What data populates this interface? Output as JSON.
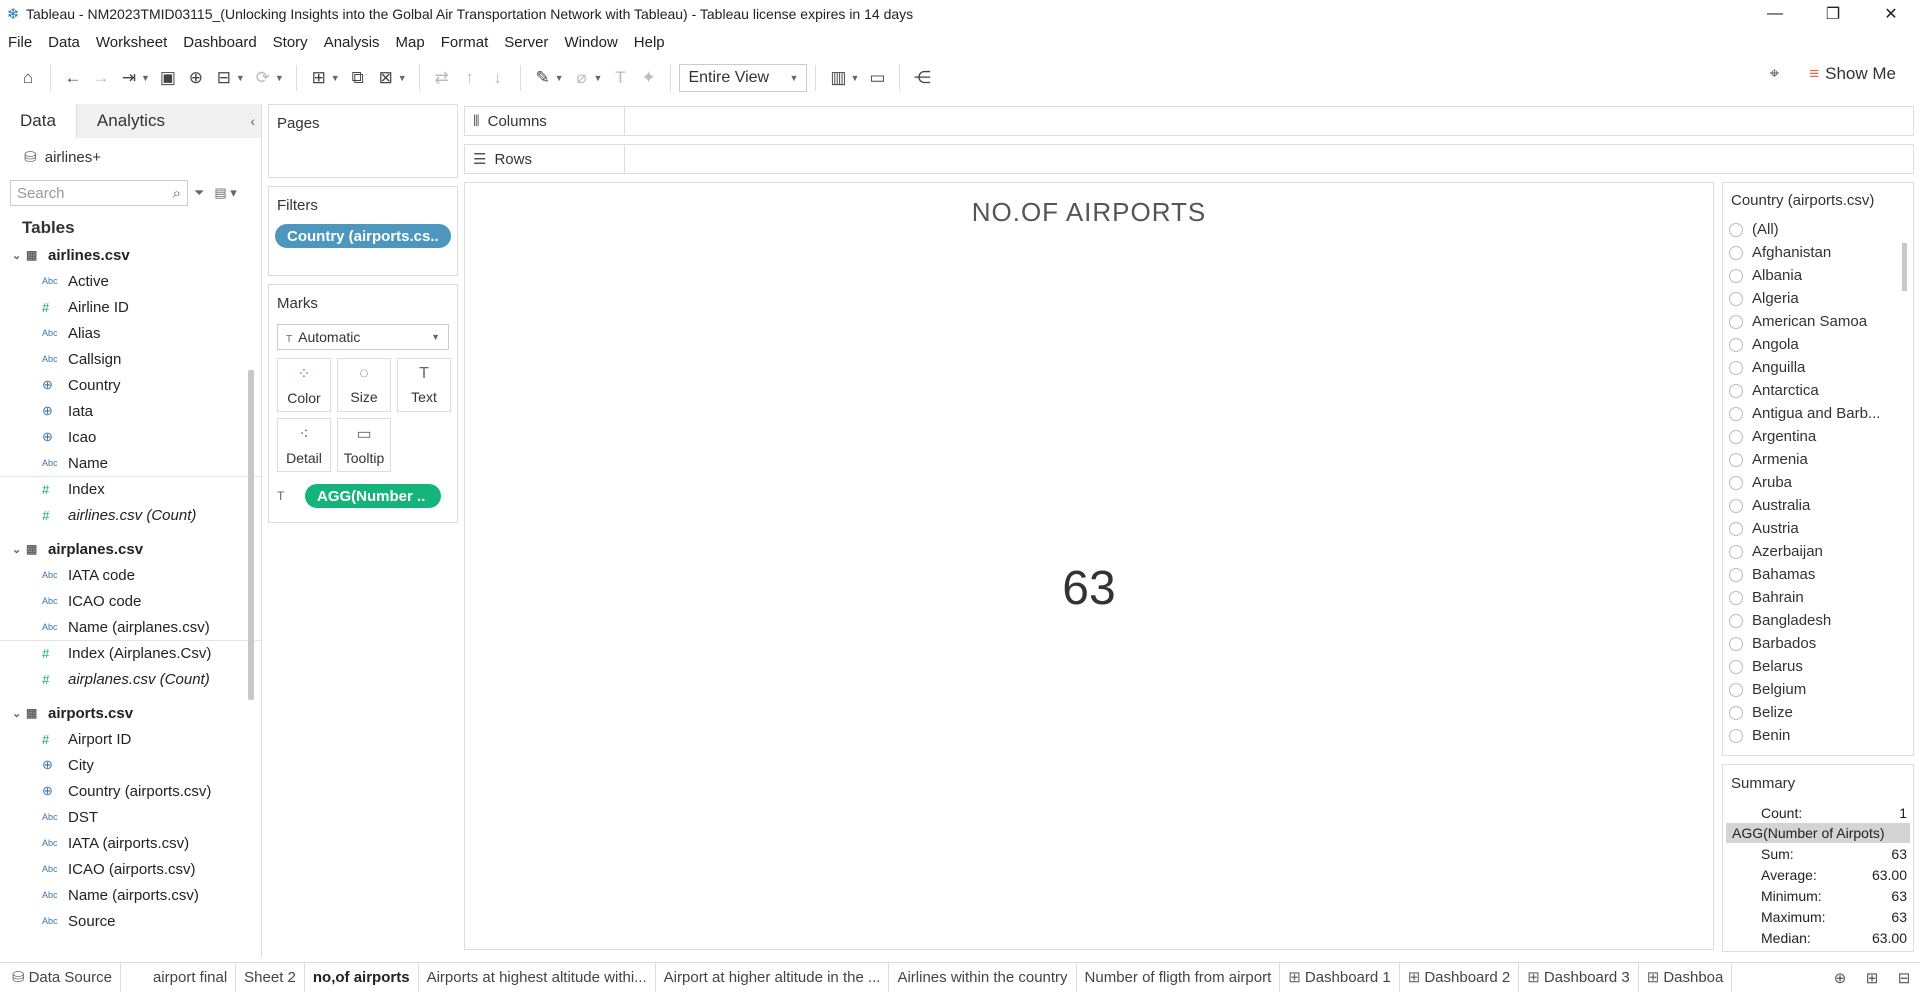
{
  "window": {
    "title": "Tableau - NM2023TMID03115_(Unlocking Insights into the Golbal Air Transportation Network with Tableau) - Tableau license expires in 14 days"
  },
  "menu": [
    "File",
    "Data",
    "Worksheet",
    "Dashboard",
    "Story",
    "Analysis",
    "Map",
    "Format",
    "Server",
    "Window",
    "Help"
  ],
  "toolbar": {
    "view_select": "Entire View",
    "show_me": "Show Me"
  },
  "left": {
    "tab_data": "Data",
    "tab_analytics": "Analytics",
    "datasource": "airlines+",
    "search_placeholder": "Search",
    "tables_heading": "Tables",
    "tables": [
      {
        "name": "airlines.csv",
        "fields": [
          {
            "type": "Abc",
            "name": "Active"
          },
          {
            "type": "#",
            "name": "Airline ID"
          },
          {
            "type": "Abc",
            "name": "Alias"
          },
          {
            "type": "Abc",
            "name": "Callsign"
          },
          {
            "type": "geo",
            "name": "Country"
          },
          {
            "type": "geo",
            "name": "Iata"
          },
          {
            "type": "geo",
            "name": "Icao"
          },
          {
            "type": "Abc",
            "name": "Name"
          },
          {
            "type": "#",
            "name": "Index"
          },
          {
            "type": "#",
            "name": "airlines.csv (Count)"
          }
        ]
      },
      {
        "name": "airplanes.csv",
        "fields": [
          {
            "type": "Abc",
            "name": "IATA code"
          },
          {
            "type": "Abc",
            "name": "ICAO code"
          },
          {
            "type": "Abc",
            "name": "Name (airplanes.csv)"
          },
          {
            "type": "#",
            "name": "Index (Airplanes.Csv)"
          },
          {
            "type": "#",
            "name": "airplanes.csv (Count)"
          }
        ]
      },
      {
        "name": "airports.csv",
        "fields": [
          {
            "type": "#",
            "name": "Airport ID"
          },
          {
            "type": "geo",
            "name": "City"
          },
          {
            "type": "geo",
            "name": "Country (airports.csv)"
          },
          {
            "type": "Abc",
            "name": "DST"
          },
          {
            "type": "Abc",
            "name": "IATA (airports.csv)"
          },
          {
            "type": "Abc",
            "name": "ICAO (airports.csv)"
          },
          {
            "type": "Abc",
            "name": "Name (airports.csv)"
          },
          {
            "type": "Abc",
            "name": "Source"
          }
        ]
      }
    ]
  },
  "shelves": {
    "pages": "Pages",
    "filters": "Filters",
    "filter_pill": "Country (airports.cs..",
    "marks": "Marks",
    "mark_type": "Automatic",
    "mark_buttons": [
      "Color",
      "Size",
      "Text",
      "Detail",
      "Tooltip"
    ],
    "mark_pill": "AGG(Number ..",
    "columns": "Columns",
    "rows": "Rows"
  },
  "viz": {
    "title": "NO.OF AIRPORTS",
    "value": "63"
  },
  "filter_card": {
    "title": "Country (airports.csv)",
    "options": [
      "(All)",
      "Afghanistan",
      "Albania",
      "Algeria",
      "American Samoa",
      "Angola",
      "Anguilla",
      "Antarctica",
      "Antigua and Barb...",
      "Argentina",
      "Armenia",
      "Aruba",
      "Australia",
      "Austria",
      "Azerbaijan",
      "Bahamas",
      "Bahrain",
      "Bangladesh",
      "Barbados",
      "Belarus",
      "Belgium",
      "Belize",
      "Benin"
    ]
  },
  "summary": {
    "title": "Summary",
    "count_label": "Count:",
    "count": "1",
    "measure": "AGG(Number of Airpots)",
    "rows": [
      {
        "label": "Sum:",
        "value": "63"
      },
      {
        "label": "Average:",
        "value": "63.00"
      },
      {
        "label": "Minimum:",
        "value": "63"
      },
      {
        "label": "Maximum:",
        "value": "63"
      },
      {
        "label": "Median:",
        "value": "63.00"
      }
    ]
  },
  "sheet_tabs": [
    {
      "label": "Data Source",
      "icon": "data-source"
    },
    {
      "label": "airport final",
      "icon": ""
    },
    {
      "label": "Sheet 2",
      "icon": ""
    },
    {
      "label": "no,of airports",
      "icon": "",
      "selected": true
    },
    {
      "label": "Airports at highest altitude withi...",
      "icon": ""
    },
    {
      "label": "Airport at higher altitude in the ...",
      "icon": ""
    },
    {
      "label": "Airlines within the country",
      "icon": ""
    },
    {
      "label": "Number of fligth from airport",
      "icon": ""
    },
    {
      "label": "Dashboard 1",
      "icon": "dashboard"
    },
    {
      "label": "Dashboard 2",
      "icon": "dashboard"
    },
    {
      "label": "Dashboard 3",
      "icon": "dashboard"
    },
    {
      "label": "Dashboa",
      "icon": "dashboard"
    }
  ]
}
